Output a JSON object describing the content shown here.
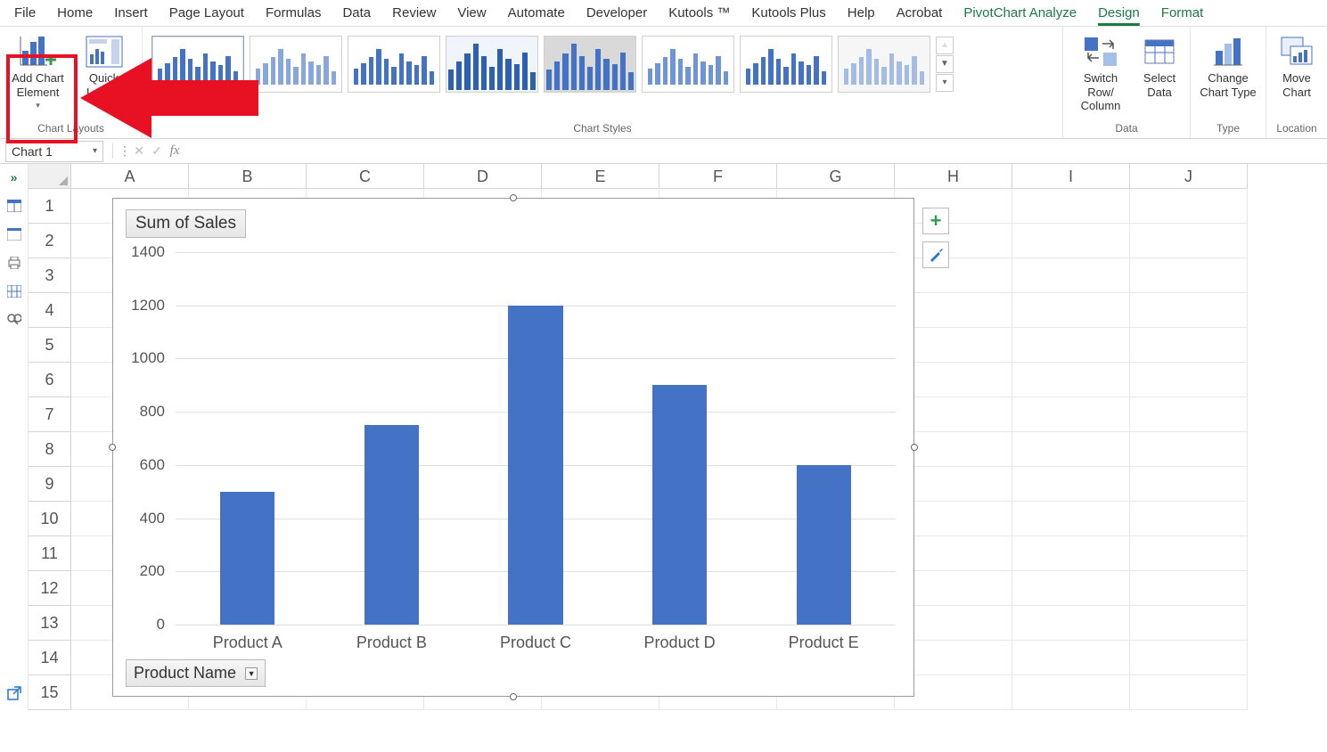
{
  "menu": {
    "items": [
      "File",
      "Home",
      "Insert",
      "Page Layout",
      "Formulas",
      "Data",
      "Review",
      "View",
      "Automate",
      "Developer",
      "Kutools ™",
      "Kutools Plus",
      "Help",
      "Acrobat",
      "PivotChart Analyze",
      "Design",
      "Format"
    ],
    "active_index": 15,
    "green_indices": [
      14,
      15,
      16
    ]
  },
  "ribbon": {
    "groups": {
      "chart_layouts": {
        "label": "Chart Layouts",
        "add_element": "Add Chart Element",
        "quick_layout": "Quick Layout"
      },
      "chart_styles": {
        "label": "Chart Styles"
      },
      "data": {
        "label": "Data",
        "switch_rowcol": "Switch Row/\nColumn",
        "select_data": "Select Data"
      },
      "type": {
        "label": "Type",
        "change_type": "Change Chart Type"
      },
      "location": {
        "label": "Location",
        "move_chart": "Move Chart"
      }
    }
  },
  "formula_bar": {
    "name_box": "Chart 1",
    "formula": ""
  },
  "grid": {
    "columns": [
      "A",
      "B",
      "C",
      "D",
      "E",
      "F",
      "G",
      "H",
      "I",
      "J"
    ],
    "rows": [
      1,
      2,
      3,
      4,
      5,
      6,
      7,
      8,
      9,
      10,
      11,
      12,
      13,
      14,
      15
    ]
  },
  "chart_data": {
    "type": "bar",
    "title": "Sum of Sales",
    "categories": [
      "Product A",
      "Product B",
      "Product C",
      "Product D",
      "Product E"
    ],
    "values": [
      500,
      750,
      1200,
      900,
      600
    ],
    "ylim": [
      0,
      1400
    ],
    "yticks": [
      0,
      200,
      400,
      600,
      800,
      1000,
      1200,
      1400
    ],
    "axis_field": "Product Name",
    "series_color": "#4472c4"
  },
  "annotation": {
    "highlight_target": "Add Chart Element"
  }
}
